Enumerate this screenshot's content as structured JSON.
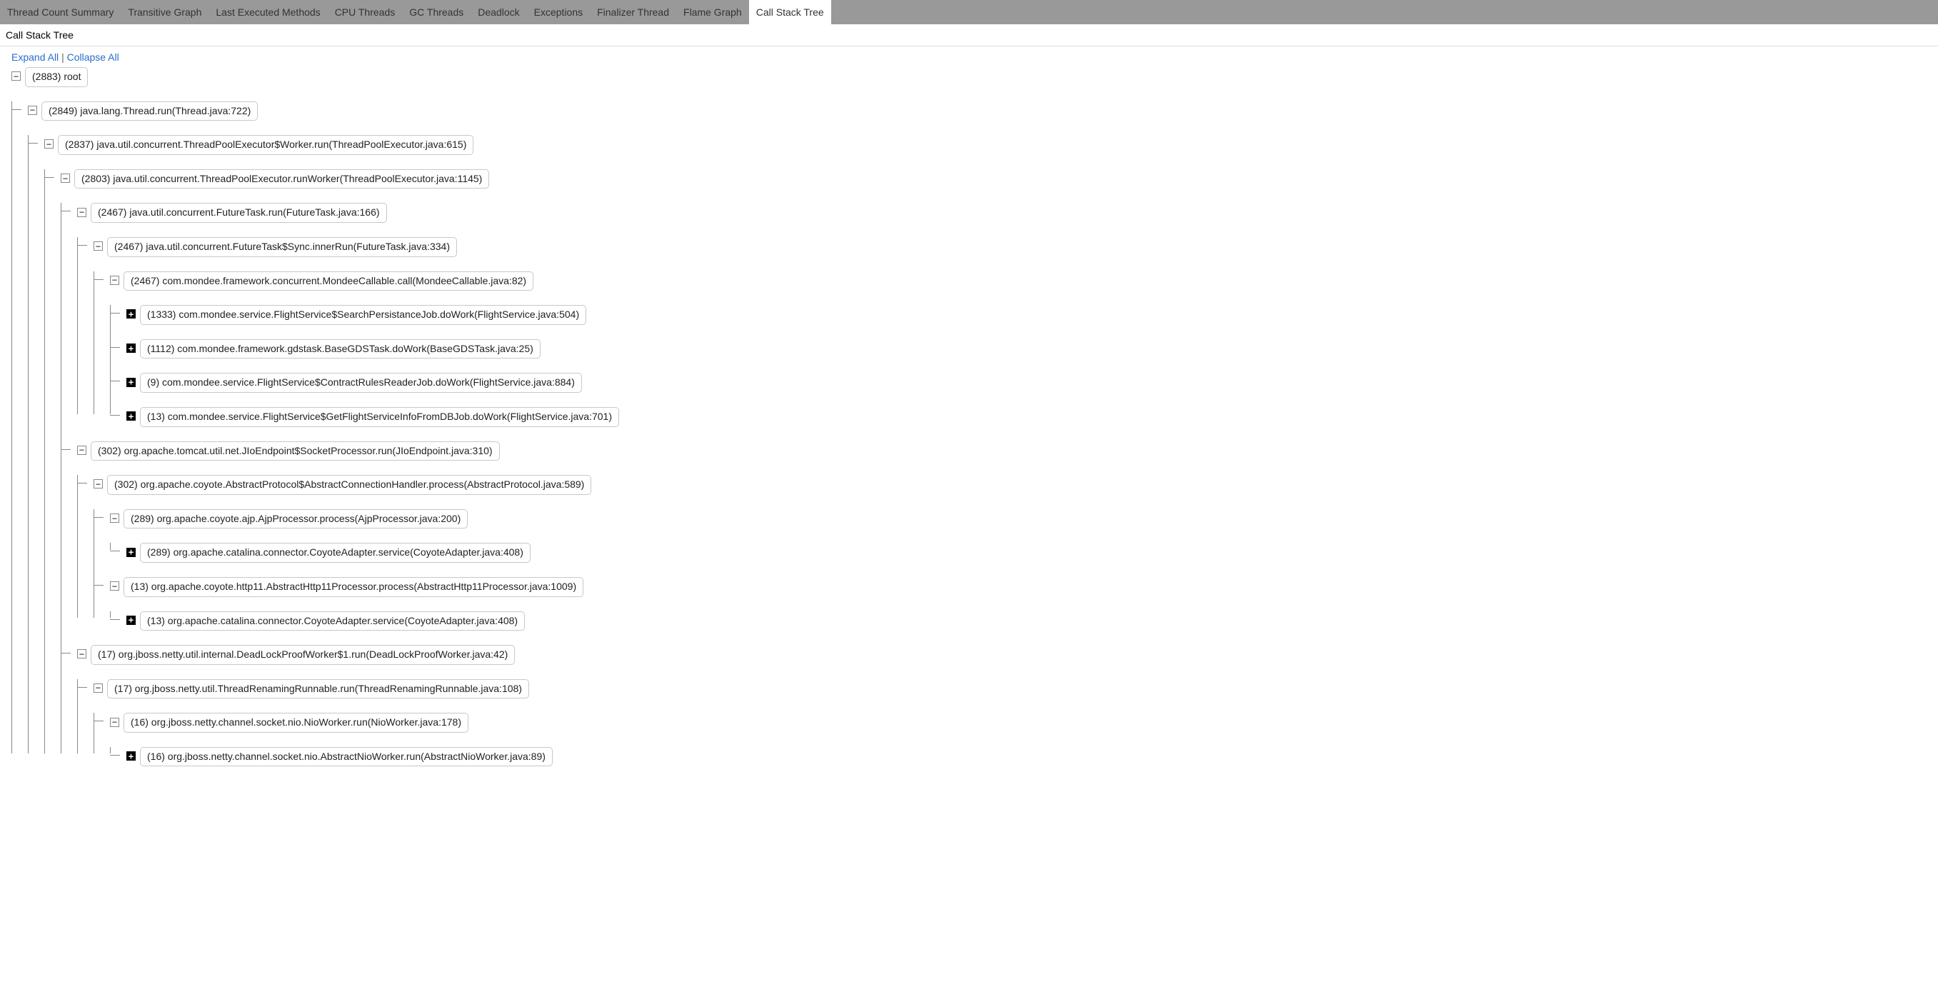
{
  "tabs": [
    {
      "label": "Thread Count Summary",
      "active": false
    },
    {
      "label": "Transitive Graph",
      "active": false
    },
    {
      "label": "Last Executed Methods",
      "active": false
    },
    {
      "label": "CPU Threads",
      "active": false
    },
    {
      "label": "GC Threads",
      "active": false
    },
    {
      "label": "Deadlock",
      "active": false
    },
    {
      "label": "Exceptions",
      "active": false
    },
    {
      "label": "Finalizer Thread",
      "active": false
    },
    {
      "label": "Flame Graph",
      "active": false
    },
    {
      "label": "Call Stack Tree",
      "active": true
    }
  ],
  "header": {
    "title": "Call Stack Tree"
  },
  "controls": {
    "expand": "Expand All",
    "collapse": "Collapse All",
    "sep": "|"
  },
  "nodes": {
    "n0": "(2883) root",
    "n1": "(2849) java.lang.Thread.run(Thread.java:722)",
    "n2": "(2837) java.util.concurrent.ThreadPoolExecutor$Worker.run(ThreadPoolExecutor.java:615)",
    "n3": "(2803) java.util.concurrent.ThreadPoolExecutor.runWorker(ThreadPoolExecutor.java:1145)",
    "n4": "(2467) java.util.concurrent.FutureTask.run(FutureTask.java:166)",
    "n5": "(2467) java.util.concurrent.FutureTask$Sync.innerRun(FutureTask.java:334)",
    "n6": "(2467) com.mondee.framework.concurrent.MondeeCallable.call(MondeeCallable.java:82)",
    "n7": "(1333) com.mondee.service.FlightService$SearchPersistanceJob.doWork(FlightService.java:504)",
    "n8": "(1112) com.mondee.framework.gdstask.BaseGDSTask.doWork(BaseGDSTask.java:25)",
    "n9": "(9) com.mondee.service.FlightService$ContractRulesReaderJob.doWork(FlightService.java:884)",
    "n10": "(13) com.mondee.service.FlightService$GetFlightServiceInfoFromDBJob.doWork(FlightService.java:701)",
    "n11": "(302) org.apache.tomcat.util.net.JIoEndpoint$SocketProcessor.run(JIoEndpoint.java:310)",
    "n12": "(302) org.apache.coyote.AbstractProtocol$AbstractConnectionHandler.process(AbstractProtocol.java:589)",
    "n13": "(289) org.apache.coyote.ajp.AjpProcessor.process(AjpProcessor.java:200)",
    "n14": "(289) org.apache.catalina.connector.CoyoteAdapter.service(CoyoteAdapter.java:408)",
    "n15": "(13) org.apache.coyote.http11.AbstractHttp11Processor.process(AbstractHttp11Processor.java:1009)",
    "n16": "(13) org.apache.catalina.connector.CoyoteAdapter.service(CoyoteAdapter.java:408)",
    "n17": "(17) org.jboss.netty.util.internal.DeadLockProofWorker$1.run(DeadLockProofWorker.java:42)",
    "n18": "(17) org.jboss.netty.util.ThreadRenamingRunnable.run(ThreadRenamingRunnable.java:108)",
    "n19": "(16) org.jboss.netty.channel.socket.nio.NioWorker.run(NioWorker.java:178)",
    "n20": "(16) org.jboss.netty.channel.socket.nio.AbstractNioWorker.run(AbstractNioWorker.java:89)"
  }
}
